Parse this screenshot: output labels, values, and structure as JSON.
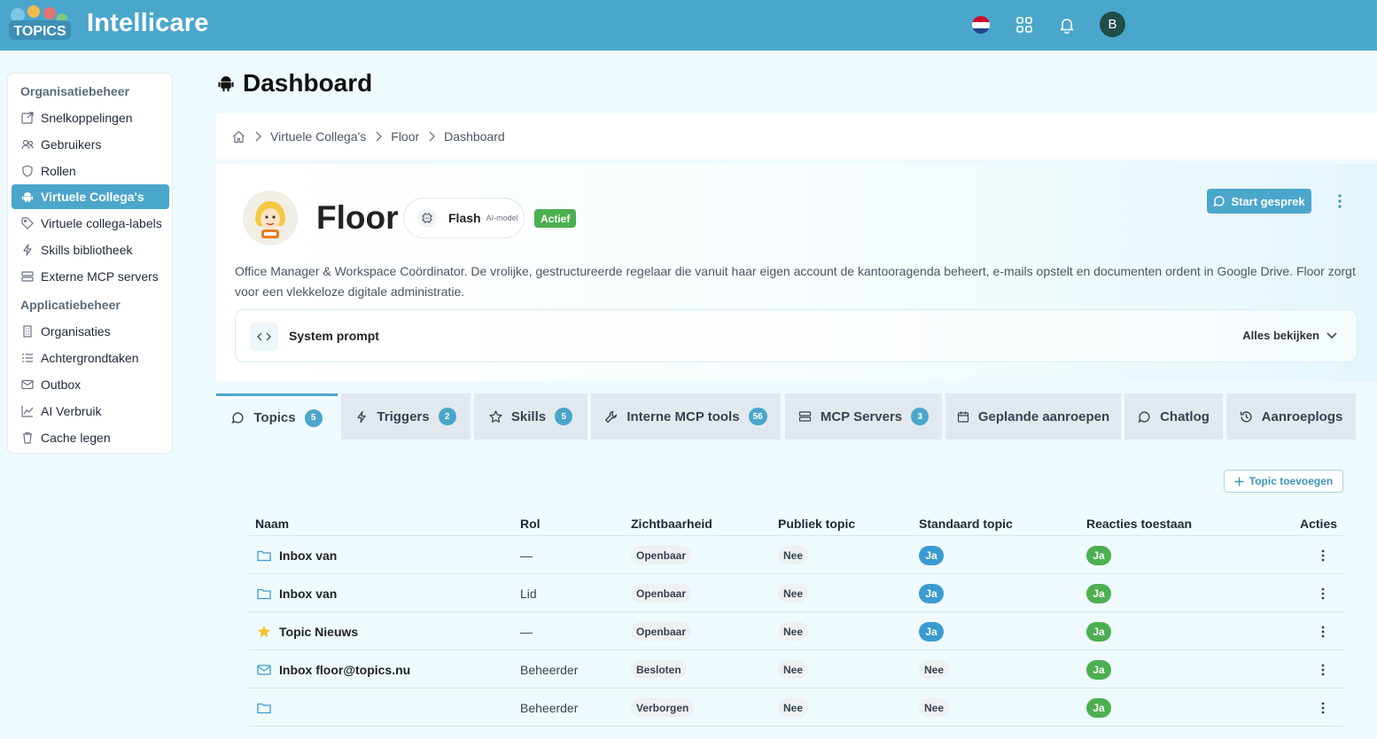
{
  "header": {
    "app_title": "Intellicare",
    "logo_text": "TOPICS",
    "avatar_initial": "B",
    "icons": [
      "flag-nl-icon",
      "apps-grid-icon",
      "bell-icon"
    ]
  },
  "sidebar": {
    "sections": [
      {
        "title": "Organisatiebeheer"
      },
      {
        "title": "Applicatiebeheer"
      }
    ],
    "items": [
      {
        "label": "Snelkoppelingen",
        "icon": "external-link-icon"
      },
      {
        "label": "Gebruikers",
        "icon": "users-icon"
      },
      {
        "label": "Rollen",
        "icon": "shield-icon"
      },
      {
        "label": "Virtuele Collega's",
        "icon": "android-icon",
        "active": true
      },
      {
        "label": "Virtuele collega-labels",
        "icon": "tag-icon"
      },
      {
        "label": "Skills bibliotheek",
        "icon": "bolt-icon"
      },
      {
        "label": "Externe MCP servers",
        "icon": "server-icon"
      },
      {
        "label": "Organisaties",
        "icon": "building-icon"
      },
      {
        "label": "Achtergrondtaken",
        "icon": "list-icon"
      },
      {
        "label": "Outbox",
        "icon": "mail-icon"
      },
      {
        "label": "AI Verbruik",
        "icon": "chart-icon"
      },
      {
        "label": "Cache legen",
        "icon": "trash-icon"
      }
    ]
  },
  "page": {
    "title": "Dashboard"
  },
  "breadcrumb": [
    "Virtuele Collega's",
    "Floor",
    "Dashboard"
  ],
  "agent": {
    "name": "Floor",
    "model_name": "Flash",
    "model_tag": "AI-model",
    "status": "Actief",
    "start_label": "Start gesprek",
    "description": "Office Manager & Workspace Coördinator. De vrolijke, gestructureerde regelaar die vanuit haar eigen account de kantooragenda beheert, e-mails opstelt en documenten ordent in Google Drive. Floor zorgt voor een vlekkeloze digitale administratie.",
    "prompt_title": "System prompt",
    "prompt_view_all": "Alles bekijken"
  },
  "tabs": [
    {
      "label": "Topics",
      "count": "5",
      "icon": "chat-icon",
      "active": true
    },
    {
      "label": "Triggers",
      "count": "2",
      "icon": "bolt-icon"
    },
    {
      "label": "Skills",
      "count": "5",
      "icon": "star-icon"
    },
    {
      "label": "Interne MCP tools",
      "count": "56",
      "icon": "wrench-icon"
    },
    {
      "label": "MCP Servers",
      "count": "3",
      "icon": "server-icon"
    },
    {
      "label": "Geplande aanroepen",
      "icon": "calendar-icon"
    },
    {
      "label": "Chatlog",
      "icon": "chat-icon"
    },
    {
      "label": "Aanroeplogs",
      "icon": "history-icon"
    }
  ],
  "topics": {
    "add_label": "Topic toevoegen",
    "columns": [
      "Naam",
      "Rol",
      "Zichtbaarheid",
      "Publiek topic",
      "Standaard topic",
      "Reacties toestaan",
      "Acties"
    ],
    "rows": [
      {
        "icon": "folder-icon",
        "name": "Inbox van",
        "role": "—",
        "visibility": "Openbaar",
        "public": "Nee",
        "default": "Ja",
        "reactions": "Ja"
      },
      {
        "icon": "folder-icon",
        "name": "Inbox van",
        "role": "Lid",
        "visibility": "Openbaar",
        "public": "Nee",
        "default": "Ja",
        "reactions": "Ja"
      },
      {
        "icon": "star-icon",
        "name": "Topic Nieuws",
        "role": "—",
        "visibility": "Openbaar",
        "public": "Nee",
        "default": "Ja",
        "reactions": "Ja"
      },
      {
        "icon": "mail-icon",
        "name": "Inbox floor@topics.nu",
        "role": "Beheerder",
        "visibility": "Besloten",
        "public": "Nee",
        "default": "Nee",
        "reactions": "Ja"
      },
      {
        "icon": "folder-icon",
        "name": "",
        "role": "Beheerder",
        "visibility": "Verborgen",
        "public": "Nee",
        "default": "Nee",
        "reactions": "Ja"
      }
    ]
  },
  "colors": {
    "accent": "#4ba6cc",
    "success": "#4caf50",
    "badge_blue": "#3a9bd0",
    "background": "#eefafd"
  }
}
